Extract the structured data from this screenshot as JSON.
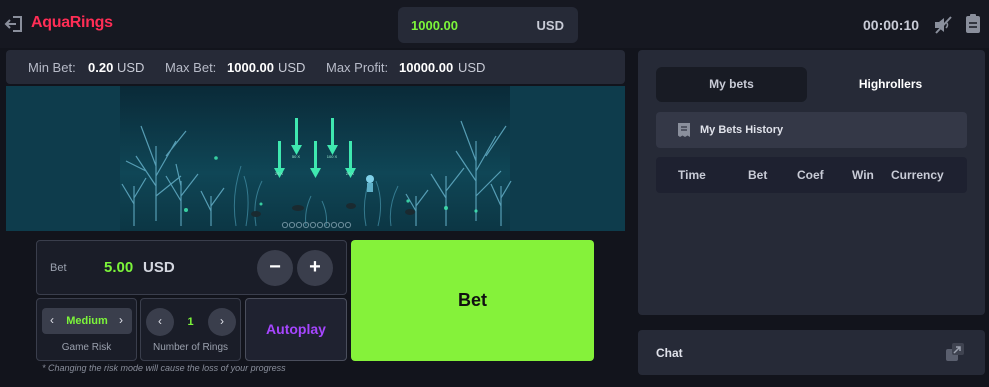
{
  "app": {
    "title": "AquaRings"
  },
  "balance": {
    "amount": "1000.00",
    "currency": "USD"
  },
  "timer": "00:00:10",
  "limits": {
    "min_label": "Min Bet:",
    "min_value": "0.20",
    "min_currency": "USD",
    "max_label": "Max Bet:",
    "max_value": "1000.00",
    "max_currency": "USD",
    "profit_label": "Max Profit:",
    "profit_value": "10000.00",
    "profit_currency": "USD"
  },
  "scene": {
    "multipliers": [
      "20 X",
      "50 X",
      "100 X",
      "20 X"
    ],
    "ring_slots": 10
  },
  "bet": {
    "label": "Bet",
    "amount": "5.00",
    "currency": "USD",
    "minus": "−",
    "plus": "+"
  },
  "risk": {
    "value": "Medium",
    "caption": "Game Risk",
    "prev": "‹",
    "next": "›"
  },
  "rings": {
    "value": "1",
    "caption": "Number of Rings",
    "prev": "‹",
    "next": "›"
  },
  "autoplay_label": "Autoplay",
  "bet_button_label": "Bet",
  "note": "* Changing the risk mode will cause the loss of your progress",
  "tabs": {
    "my_bets": "My bets",
    "highrollers": "Highrollers"
  },
  "history_label": "My Bets History",
  "table_columns": [
    "Time",
    "Bet",
    "Coef",
    "Win",
    "Currency"
  ],
  "chat_label": "Chat",
  "icons": {
    "exit": "exit-icon",
    "sound": "sound-muted-icon",
    "clipboard": "clipboard-icon",
    "history": "receipt-icon",
    "chat": "expand-icon"
  },
  "colors": {
    "accent_green": "#85f23a",
    "logo_red": "#ff2d55",
    "autoplay_purple": "#a646ff",
    "value_green": "#7cf53a"
  }
}
